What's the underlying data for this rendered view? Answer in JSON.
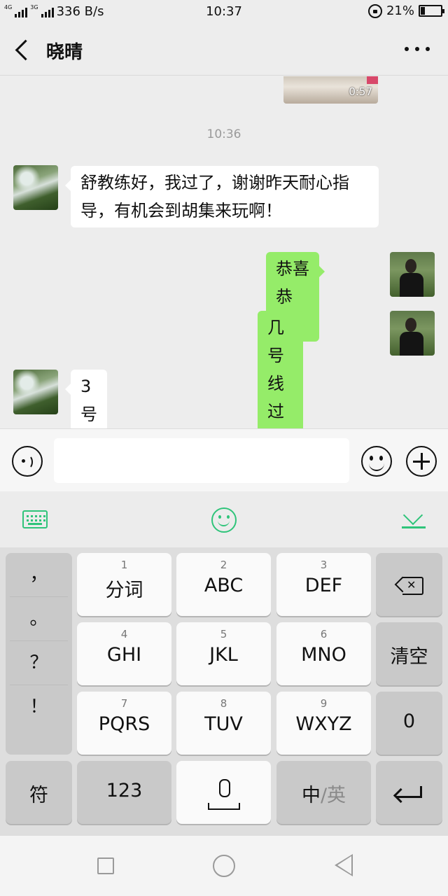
{
  "status_bar": {
    "sim1_net": "4G",
    "sim2_net": "3G",
    "speed": "336 B/s",
    "time": "10:37",
    "battery": "21%",
    "battery_level": 0.21
  },
  "header": {
    "title": "晓晴"
  },
  "messages": {
    "video": {
      "duration": "0:57"
    },
    "timestamp": "10:36",
    "items": [
      {
        "side": "left",
        "text": "舒教练好，我过了，谢谢昨天耐心指导，有机会到胡集来玩啊！"
      },
      {
        "side": "right",
        "text": "恭喜恭喜！"
      },
      {
        "side": "right",
        "text": "几号线过的?"
      },
      {
        "side": "left",
        "text": "3号"
      }
    ]
  },
  "input": {
    "value": "",
    "placeholder": ""
  },
  "keyboard": {
    "punctuation": [
      "，",
      "。",
      "？",
      "！"
    ],
    "keys": [
      {
        "num": "1",
        "label": "分词"
      },
      {
        "num": "2",
        "label": "ABC"
      },
      {
        "num": "3",
        "label": "DEF"
      },
      {
        "num": "4",
        "label": "GHI"
      },
      {
        "num": "5",
        "label": "JKL"
      },
      {
        "num": "6",
        "label": "MNO"
      },
      {
        "num": "7",
        "label": "PQRS"
      },
      {
        "num": "8",
        "label": "TUV"
      },
      {
        "num": "9",
        "label": "WXYZ"
      }
    ],
    "clear_label": "清空",
    "zero_label": "0",
    "symbol_label": "符",
    "numeric_label": "123",
    "lang_primary": "中",
    "lang_sep": "/",
    "lang_secondary": "英"
  },
  "colors": {
    "accent": "#2fc47a",
    "sent_bubble": "#95ec69",
    "received_bubble": "#ffffff"
  },
  "icons": {
    "back": "back-chevron-icon",
    "more": "more-dots-icon",
    "voice": "voice-input-icon",
    "emoji": "emoji-icon",
    "plus": "plus-icon",
    "backspace": "backspace-icon",
    "mic": "microphone-icon",
    "enter": "enter-icon"
  }
}
